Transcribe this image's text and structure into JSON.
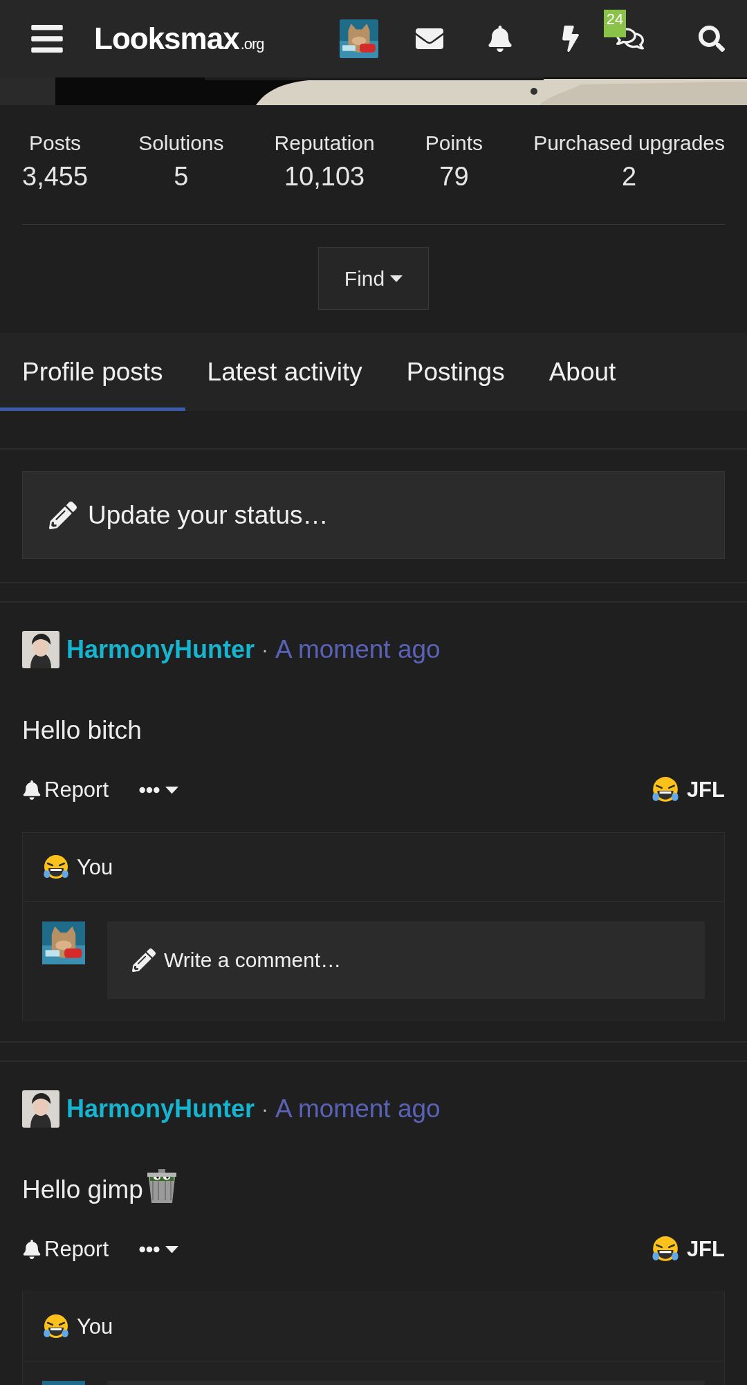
{
  "header": {
    "logo": "Looksmax",
    "logo_suffix": ".org",
    "badge": "24"
  },
  "stats": [
    {
      "label": "Posts",
      "value": "3,455"
    },
    {
      "label": "Solutions",
      "value": "5"
    },
    {
      "label": "Reputation",
      "value": "10,103"
    },
    {
      "label": "Points",
      "value": "79"
    },
    {
      "label": "Purchased upgrades",
      "value": "2"
    }
  ],
  "find_button": "Find",
  "tabs": [
    {
      "label": "Profile posts",
      "selected": true
    },
    {
      "label": "Latest activity",
      "selected": false
    },
    {
      "label": "Postings",
      "selected": false
    },
    {
      "label": "About",
      "selected": false
    }
  ],
  "status_placeholder": "Update your status…",
  "posts": [
    {
      "author": "HarmonyHunter",
      "separator": "·",
      "time": "A moment ago",
      "text": "Hello bitch",
      "has_sticker": false,
      "report": "Report",
      "reaction": "JFL",
      "reactors": "You",
      "comment_placeholder": "Write a comment…"
    },
    {
      "author": "HarmonyHunter",
      "separator": "·",
      "time": "A moment ago",
      "text": "Hello gimp",
      "has_sticker": true,
      "report": "Report",
      "reaction": "JFL",
      "reactors": "You"
    }
  ]
}
